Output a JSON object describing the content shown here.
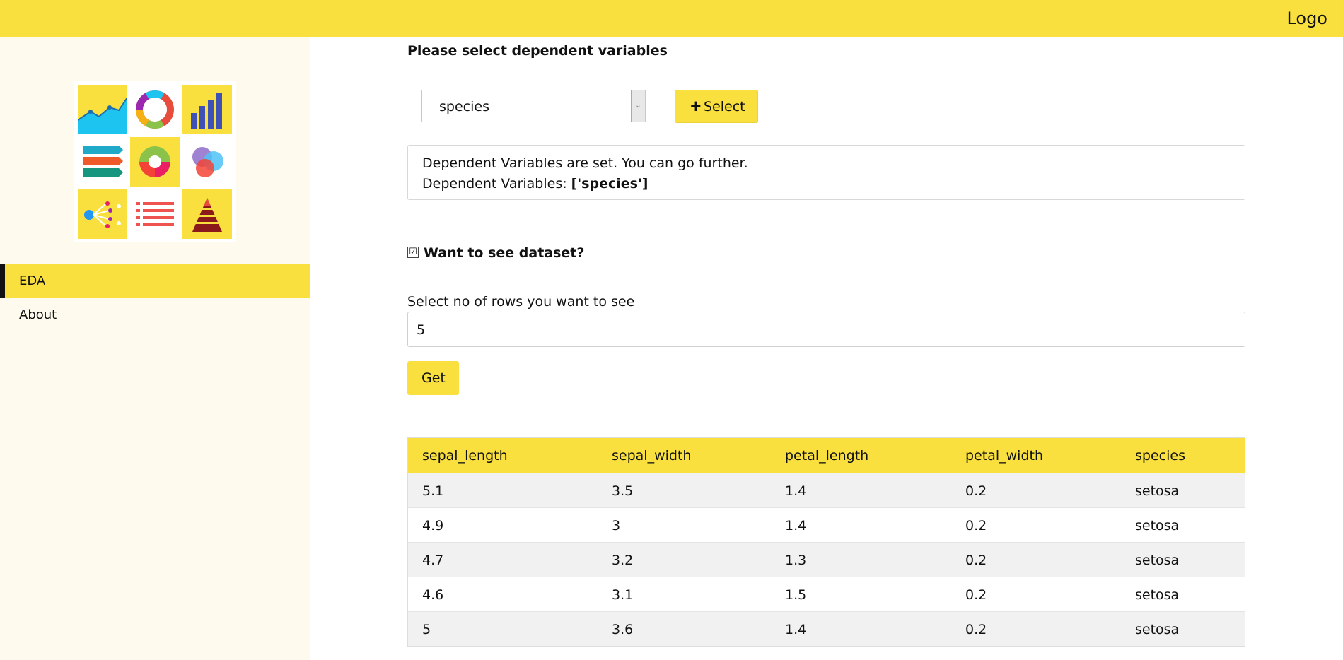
{
  "header": {
    "logo_text": "Logo"
  },
  "sidebar": {
    "nav": [
      {
        "label": "EDA",
        "active": true
      },
      {
        "label": "About",
        "active": false
      }
    ]
  },
  "main": {
    "heading": "Please select dependent variables",
    "variable_select": {
      "selected": "species"
    },
    "select_button": {
      "icon": "plus-icon",
      "label": "Select"
    },
    "message": {
      "line1": "Dependent Variables are set. You can go further.",
      "line2_prefix": "Dependent Variables:",
      "line2_value": "['species']"
    },
    "show_dataset": {
      "label": "Want to see dataset?",
      "checked": true,
      "mark": "☑"
    },
    "rows_field": {
      "label": "Select no of rows you want to see",
      "value": "5"
    },
    "get_button": {
      "label": "Get"
    },
    "table": {
      "columns": [
        "sepal_length",
        "sepal_width",
        "petal_length",
        "petal_width",
        "species"
      ],
      "rows": [
        [
          "5.1",
          "3.5",
          "1.4",
          "0.2",
          "setosa"
        ],
        [
          "4.9",
          "3",
          "1.4",
          "0.2",
          "setosa"
        ],
        [
          "4.7",
          "3.2",
          "1.3",
          "0.2",
          "setosa"
        ],
        [
          "4.6",
          "3.1",
          "1.5",
          "0.2",
          "setosa"
        ],
        [
          "5",
          "3.6",
          "1.4",
          "0.2",
          "setosa"
        ]
      ]
    }
  },
  "colors": {
    "accent": "#f9e03e",
    "sidebar_bg": "#fffaee",
    "row_alt": "#f1f1f1"
  }
}
